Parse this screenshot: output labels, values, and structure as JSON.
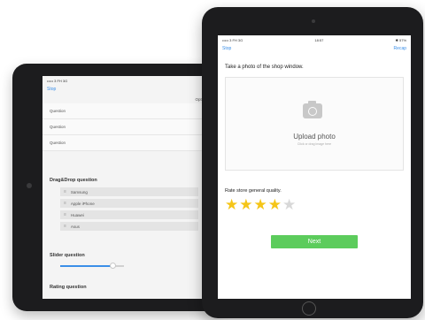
{
  "back": {
    "status": {
      "left": "••••• 3 FH  3G",
      "right": "18:57"
    },
    "nav": {
      "back_label": "Stop"
    },
    "options_header": "Options",
    "questions": [
      {
        "label": "Question",
        "checked": false
      },
      {
        "label": "Question",
        "checked": true
      },
      {
        "label": "Question",
        "checked": false
      }
    ],
    "drag_title": "Drag&Drop question",
    "drag_items": [
      "Samsung",
      "Apple iPhone",
      "Huawei",
      "Asus"
    ],
    "slider_title": "Slider question",
    "slider_value": 0.82,
    "rating_title": "Rating question"
  },
  "front": {
    "status": {
      "left": "••••• 3 FH  3G",
      "center": "18:57",
      "right": "✱ 57%"
    },
    "nav": {
      "left": "Stop",
      "right": "Recap"
    },
    "photo_title": "Take a photo of the shop window.",
    "upload_label": "Upload photo",
    "upload_sub": "Click or drag image here",
    "rate_title": "Rate store general quality.",
    "rating": {
      "value": 4,
      "max": 5
    },
    "next_label": "Next"
  },
  "colors": {
    "accent": "#3b8fe8",
    "next": "#5ccc5c",
    "star": "#f5c518"
  }
}
